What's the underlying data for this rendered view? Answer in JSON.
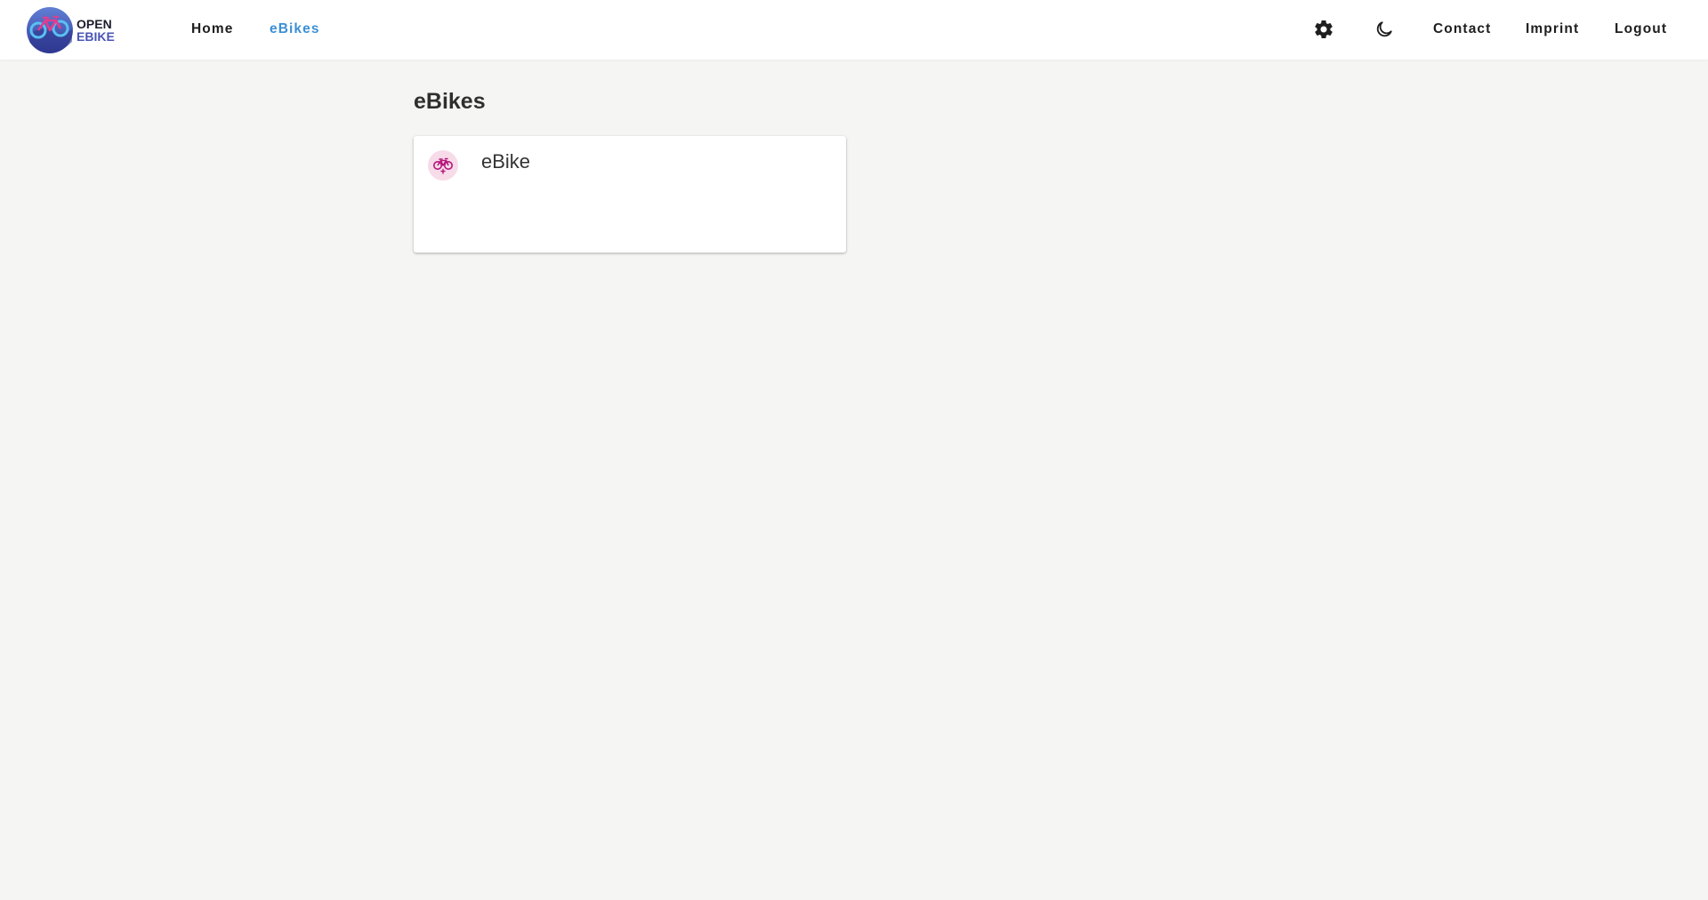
{
  "header": {
    "logo": {
      "line1": "OPEN",
      "line2": "EBIKE"
    },
    "nav": [
      {
        "label": "Home",
        "active": false
      },
      {
        "label": "eBikes",
        "active": true
      }
    ],
    "icons": [
      "gear-icon",
      "moon-icon"
    ],
    "right_links": [
      "Contact",
      "Imprint",
      "Logout"
    ]
  },
  "main": {
    "title": "eBikes",
    "cards": [
      {
        "title": "eBike",
        "icon": "bicycle-icon"
      }
    ]
  },
  "colors": {
    "background": "#f5f5f3",
    "accent": "#3b8fd6",
    "card_icon": "#b5177a",
    "card_icon_bg": "#f7dbe9"
  }
}
